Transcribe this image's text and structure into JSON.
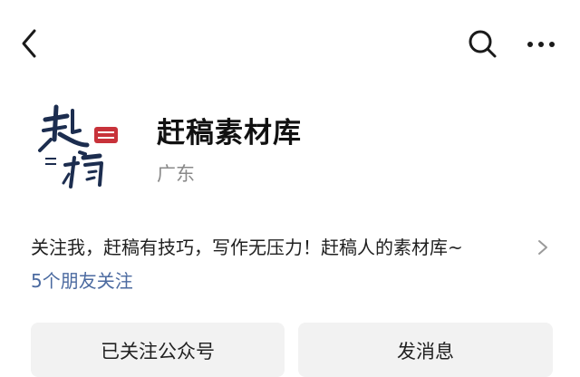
{
  "header": {
    "back_icon": "chevron-left-icon",
    "search_icon": "search-icon",
    "more_icon": "more-horizontal-icon"
  },
  "account": {
    "logo_icon": "account-logo",
    "name": "赶稿素材库",
    "region": "广东"
  },
  "intro": {
    "text": "关注我，赶稿有技巧，写作无压力！赶稿人的素材库~",
    "chevron_icon": "chevron-right-icon"
  },
  "friends_following": "5个朋友关注",
  "actions": {
    "followed_label": "已关注公众号",
    "message_label": "发消息"
  },
  "colors": {
    "friends_link": "#4b6aa0",
    "button_bg": "#f2f2f2",
    "logo_ink": "#1c2d4f",
    "logo_seal": "#c8323a"
  }
}
